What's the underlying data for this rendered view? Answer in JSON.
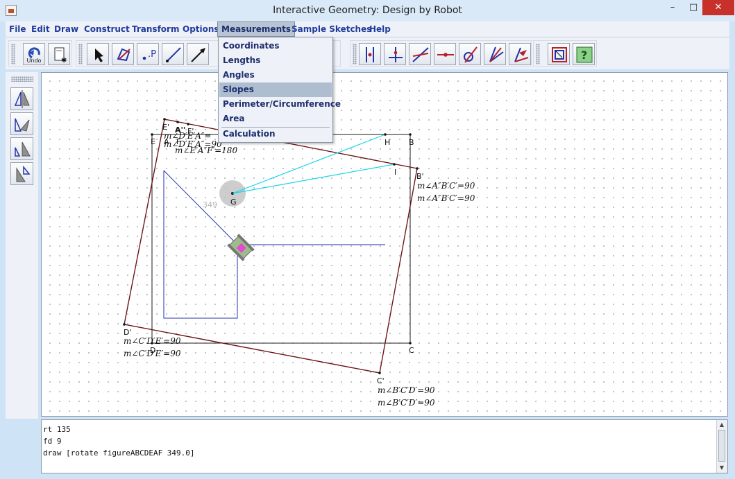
{
  "window": {
    "title": "Interactive Geometry: Design by Robot",
    "controls": {
      "minimize": "–",
      "maximize": "□",
      "close": "✕"
    }
  },
  "menubar": [
    "File",
    "Edit",
    "Draw",
    "Construct",
    "Transform",
    "Options",
    "Measurements",
    "Sample Sketches",
    "Help"
  ],
  "measurements_menu": {
    "items": [
      "Coordinates",
      "Lengths",
      "Angles",
      "Slopes",
      "Perimeter/Circumference",
      "Area",
      "Calculation"
    ],
    "highlighted": "Slopes"
  },
  "toolbar": {
    "undo_label": "Undo",
    "point_label": ".P",
    "buttons": [
      "undo-icon",
      "new-sketch-icon",
      "select-arrow-icon",
      "polygon-icon",
      "point-icon",
      "segment-icon",
      "ray-icon",
      "perpendicular-icon",
      "perpendicular-bisector-icon",
      "parallel-icon",
      "midpoint-icon",
      "angle-bisector-icon",
      "angle-icon",
      "vector-icon",
      "reset-view-icon",
      "help-icon"
    ]
  },
  "sidebar": {
    "buttons": [
      "reflect-icon",
      "rotate-icon",
      "dilate-icon",
      "translate-icon"
    ]
  },
  "canvas": {
    "point_labels": {
      "E_prime": "E'",
      "A_double_prime": "A''",
      "F_prime": "F'",
      "E": "E",
      "A": "A",
      "F": "F",
      "H": "H",
      "B": "B",
      "I": "I",
      "B_prime": "B'",
      "G": "G",
      "D_prime": "D'",
      "D": "D",
      "C": "C",
      "C_prime": "C'"
    },
    "rotation_value": "349",
    "measurements": {
      "near_B_prime": [
        "m∠A″B′C′=90",
        "m∠A″B′C′=90"
      ],
      "near_D_prime": [
        "m∠C′D′E′=90",
        "m∠C′D′E′=90"
      ],
      "near_C_prime": [
        "m∠B′C′D′=90",
        "m∠B′C′D′=90"
      ],
      "near_E_prime": [
        "m∠D′E′A″=",
        "m∠D′E′A″=90",
        "m∠E′A″F′=180"
      ]
    },
    "colors": {
      "figure": "#1a1a1a",
      "rotated_figure": "#7a1a1a",
      "turtle_path": "#2432a8",
      "rays": "#18d4e6"
    }
  },
  "console": {
    "lines": [
      "rt 135",
      "fd 9",
      "draw [rotate figureABCDEAF 349.0]"
    ]
  }
}
